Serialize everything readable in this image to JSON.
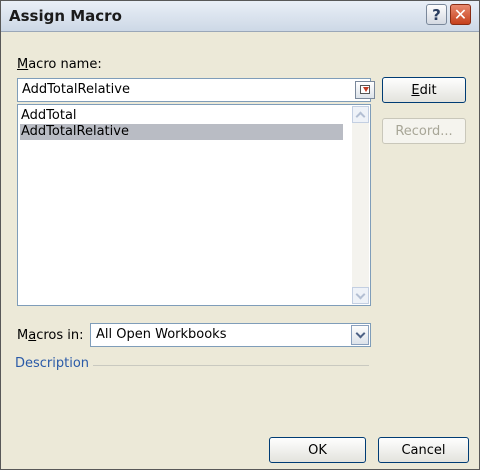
{
  "dialog": {
    "title": "Assign Macro",
    "help_glyph": "?",
    "close_glyph": "✕"
  },
  "macro_name": {
    "label_mnemonic": "M",
    "label_rest": "acro name:",
    "value": "AddTotalRelative"
  },
  "macro_list": {
    "items": [
      "AddTotal",
      "AddTotalRelative"
    ],
    "selected_index": 1
  },
  "buttons": {
    "edit_mnemonic": "E",
    "edit_rest": "dit",
    "record_label": "Record...",
    "ok_label": "OK",
    "cancel_label": "Cancel"
  },
  "macros_in": {
    "label_pre": "M",
    "label_mnemonic": "a",
    "label_post": "cros in:",
    "selected": "All Open Workbooks"
  },
  "description": {
    "label": "Description"
  }
}
